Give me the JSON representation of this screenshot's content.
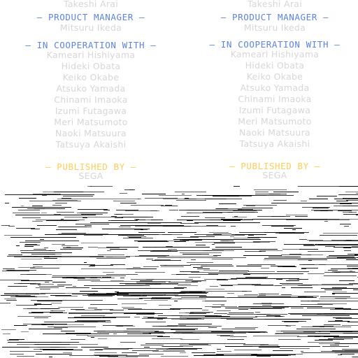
{
  "credits_left": {
    "previous_name": "Takeshi Arai",
    "product_manager": {
      "heading": "– PRODUCT MANAGER –",
      "name": "Mitsuru Ikeda"
    },
    "cooperation": {
      "heading": "– IN COOPERATION WITH –",
      "names": [
        "Kameari Hishiyama",
        "Hideki Obata",
        "Keiko Okabe",
        "Atsuko Yamada",
        "Chinami Imaoka",
        "Izumi Futagawa",
        "Meri Matsumoto",
        "Naoki Matsuura",
        "Tatsuya Akaishi"
      ]
    },
    "publisher": {
      "heading": "– PUBLISHED BY –",
      "name": "SEGA"
    }
  },
  "credits_right": {
    "previous_name": "Takeshi Arai",
    "product_manager": {
      "heading": "– PRODUCT MANAGER –",
      "name": "Mitsuru Ikeda"
    },
    "cooperation": {
      "heading": "– IN COOPERATION WITH –",
      "names": [
        "Kameari Hishiyama",
        "Hideki Obata",
        "Keiko Okabe",
        "Atsuko Yamada",
        "Chinami Imaoka",
        "Izumi Futagawa",
        "Meri Matsumoto",
        "Naoki Matsuura",
        "Tatsuya Akaishi"
      ]
    },
    "publisher": {
      "heading": "– PUBLISHED BY –",
      "name": "SEGA"
    }
  },
  "colors": {
    "background": "#ffffff",
    "name_text": "#d6d6d6",
    "heading_blue": "#5d83dd",
    "heading_gold": "#ffcc55",
    "glitch_lines": "#000000"
  }
}
